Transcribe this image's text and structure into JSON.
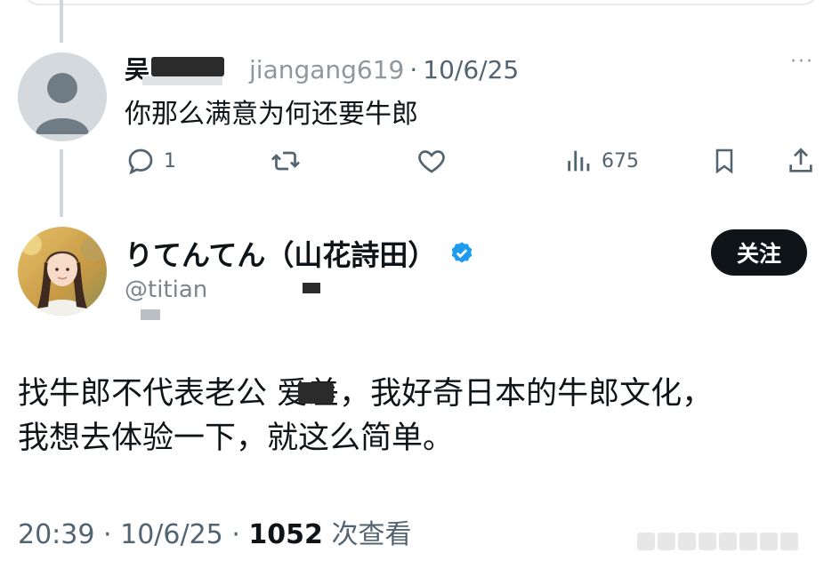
{
  "reply": {
    "name": "吴",
    "handle": "@jiangang619",
    "handle_visible": "jiangang619",
    "separator": "·",
    "date": "10/6/25",
    "more": "···",
    "text": "你那么满意为何还要牛郎",
    "actions": [
      {
        "icon": "reply-icon",
        "count": "1"
      },
      {
        "icon": "repost-icon",
        "count": ""
      },
      {
        "icon": "like-icon",
        "count": ""
      },
      {
        "icon": "views-icon",
        "count": "675"
      },
      {
        "icon": "bookmark-icon",
        "count": ""
      },
      {
        "icon": "share-icon",
        "count": ""
      }
    ]
  },
  "post": {
    "author_name": "りてんてん（山花詩田）",
    "verified": true,
    "handle": "@titian",
    "follow_label": "关注",
    "text_lines": [
      "找牛郎不代表老公 爱差，我好奇日本的牛郎文化，",
      "我想去体验一下，就这么简单。"
    ],
    "time": "20:39",
    "date": "10/6/25",
    "separator": "·",
    "views_count": "1052",
    "views_label": "次查看"
  },
  "colors": {
    "text": "#0f1419",
    "secondary": "#536471",
    "verified": "#1d9bf0",
    "follow_bg": "#0f1419",
    "follow_text": "#ffffff"
  }
}
